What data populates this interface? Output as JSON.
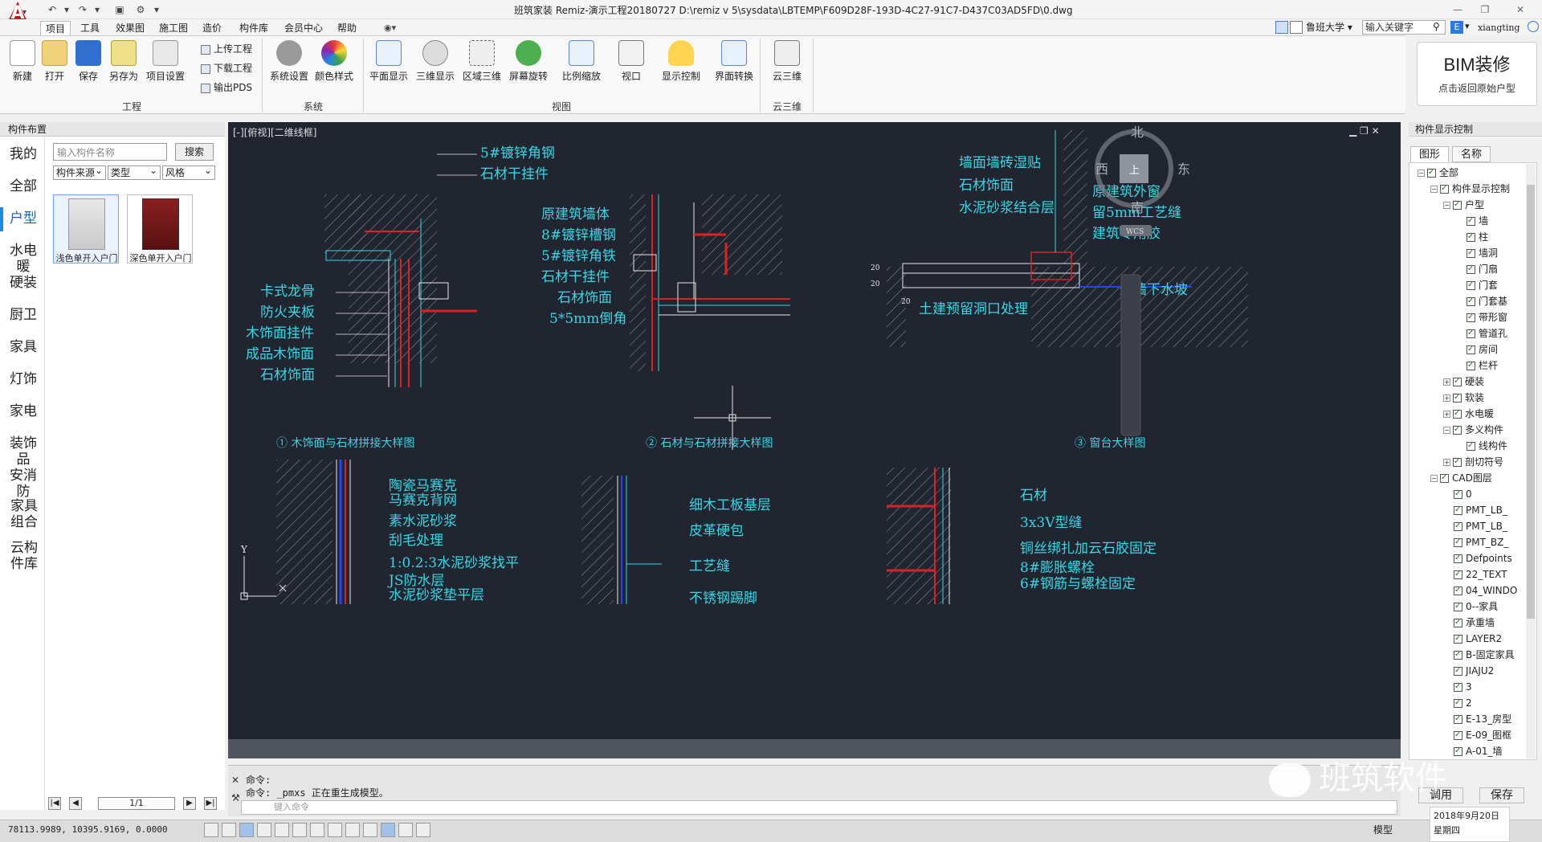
{
  "window": {
    "title": "班筑家装 Remiz-演示工程20180727     D:\\remiz v 5\\sysdata\\LBTEMP\\F609D28F-193D-4C27-91C7-D437C03AD5FD\\0.dwg",
    "logo_letter": "A",
    "minimize": "—",
    "maximize": "❐",
    "close": "✕"
  },
  "menu_tabs": [
    "项目",
    "工具",
    "效果图",
    "施工图",
    "造价",
    "构件库",
    "会员中心",
    "帮助"
  ],
  "top_right": {
    "company_select": "鲁班大学",
    "keyword_placeholder": "输入关键字",
    "user": "xiangting"
  },
  "ribbon": {
    "project_buttons": [
      "新建",
      "打开",
      "保存",
      "另存为",
      "项目设置"
    ],
    "project_small": [
      "上传工程",
      "下载工程",
      "输出PDS"
    ],
    "system_buttons": [
      "系统设置",
      "颜色样式"
    ],
    "view_buttons": [
      "平面显示",
      "三维显示",
      "区域三维",
      "屏幕旋转",
      "比例缩放",
      "视口",
      "显示控制",
      "界面转换"
    ],
    "cloud_buttons": [
      "云三维"
    ],
    "groups": [
      "工程",
      "系统",
      "视图",
      "云三维"
    ]
  },
  "bim_button": {
    "title": "BIM装修",
    "subtitle": "点击返回原始户型"
  },
  "left_panel": {
    "header": "构件布置",
    "categories": [
      "我的",
      "全部",
      "户型",
      "水电暖",
      "硬装",
      "厨卫",
      "家具",
      "灯饰",
      "家电",
      "装饰品",
      "安消防",
      "家具组合",
      "云构件库"
    ],
    "active_category": "户型",
    "search_placeholder": "输入构件名称",
    "search_button": "搜索",
    "filters": [
      "构件来源",
      "类型",
      "风格"
    ],
    "items": [
      {
        "label": "浅色单开入户门",
        "color": "#d8d8d8"
      },
      {
        "label": "深色单开入户门",
        "color": "#7a1c1c"
      }
    ],
    "page": "1/1"
  },
  "canvas": {
    "view_label": "[-][俯视][二维线框]",
    "compass": {
      "north": "北",
      "east": "东",
      "south": "南",
      "west": "西",
      "top": "上",
      "wcs": "WCS"
    },
    "axis_y": "Y",
    "drawing1": {
      "callouts": [
        "5#镀锌角钢",
        "石材干挂件",
        "卡式龙骨",
        "防火夹板",
        "木饰面挂件",
        "成品木饰面",
        "石材饰面"
      ],
      "title": "①  木饰面与石材拼接大样图"
    },
    "drawing2": {
      "callouts": [
        "原建筑墙体",
        "8#镀锌槽钢",
        "5#镀锌角铁",
        "石材干挂件",
        "石材饰面",
        "5*5mm倒角"
      ],
      "title": "②  石材与石材拼接大样图"
    },
    "drawing3": {
      "callouts": [
        "墙面墙砖湿贴",
        "石材饰面",
        "水泥砂浆结合层",
        "原建筑外窗",
        "留5mm工艺缝",
        "建筑专用胶",
        "外墙下水坡",
        "土建预留洞口处理"
      ],
      "dims": [
        "20",
        "20",
        "20"
      ],
      "title": "③  窗台大样图"
    },
    "drawing4": {
      "callouts": [
        "陶瓷马赛克",
        "马赛克背网",
        "素水泥砂浆",
        "刮毛处理",
        "1:0.2:3水泥砂浆找平",
        "JS防水层",
        "水泥砂浆垫平层"
      ]
    },
    "drawing5": {
      "callouts": [
        "细木工板基层",
        "皮革硬包",
        "工艺缝",
        "不锈钢踢脚"
      ]
    },
    "drawing6": {
      "callouts": [
        "石材",
        "3x3V型缝",
        "铜丝绑扎加云石胶固定",
        "8#膨胀螺栓",
        "6#钢筋与螺栓固定"
      ]
    },
    "colors": {
      "background": "#21252f",
      "cyan": "#38d6e6",
      "red": "#e02020",
      "white": "#e6e6e6",
      "hatch": "#9aa0aa"
    }
  },
  "command": {
    "line1": "命令:",
    "line2": "命令: _pmxs 正在重生成模型。",
    "placeholder": "键入命令"
  },
  "status": {
    "coords": "78113.9989, 10395.9169, 0.0000",
    "model": "模型"
  },
  "right_panel": {
    "header": "构件显示控制",
    "tabs": [
      "图形",
      "名称"
    ],
    "tree": [
      {
        "label": "全部",
        "level": 0,
        "expander": "−"
      },
      {
        "label": "构件显示控制",
        "level": 1,
        "expander": "−"
      },
      {
        "label": "户型",
        "level": 2,
        "expander": "−"
      },
      {
        "label": "墙",
        "level": 3
      },
      {
        "label": "柱",
        "level": 3
      },
      {
        "label": "墙洞",
        "level": 3
      },
      {
        "label": "门扇",
        "level": 3
      },
      {
        "label": "门套",
        "level": 3
      },
      {
        "label": "门套基",
        "level": 3
      },
      {
        "label": "带形窗",
        "level": 3
      },
      {
        "label": "管道孔",
        "level": 3
      },
      {
        "label": "房间",
        "level": 3
      },
      {
        "label": "栏杆",
        "level": 3
      },
      {
        "label": "硬装",
        "level": 2,
        "expander": "+"
      },
      {
        "label": "软装",
        "level": 2,
        "expander": "+"
      },
      {
        "label": "水电暖",
        "level": 2,
        "expander": "+"
      },
      {
        "label": "多义构件",
        "level": 2,
        "expander": "−"
      },
      {
        "label": "线构件",
        "level": 3
      },
      {
        "label": "剖切符号",
        "level": 2,
        "expander": "+"
      },
      {
        "label": "CAD图层",
        "level": 1,
        "expander": "−"
      },
      {
        "label": "0",
        "level": 2
      },
      {
        "label": "PMT_LB_",
        "level": 2
      },
      {
        "label": "PMT_LB_",
        "level": 2
      },
      {
        "label": "PMT_BZ_",
        "level": 2
      },
      {
        "label": "Defpoints",
        "level": 2
      },
      {
        "label": "22_TEXT",
        "level": 2
      },
      {
        "label": "04_WINDO",
        "level": 2
      },
      {
        "label": "0--家具",
        "level": 2
      },
      {
        "label": "承重墙",
        "level": 2
      },
      {
        "label": "LAYER2",
        "level": 2
      },
      {
        "label": "B-固定家具",
        "level": 2
      },
      {
        "label": "JIAJU2",
        "level": 2
      },
      {
        "label": "3",
        "level": 2
      },
      {
        "label": "2",
        "level": 2
      },
      {
        "label": "E-13_房型",
        "level": 2
      },
      {
        "label": "E-09_图框",
        "level": 2
      },
      {
        "label": "A-01_墙",
        "level": 2
      }
    ],
    "apply_button": "调用",
    "save_button": "保存",
    "clock_date": "2018年9月20日",
    "clock_day": "星期四"
  },
  "watermark": "班筑软件"
}
